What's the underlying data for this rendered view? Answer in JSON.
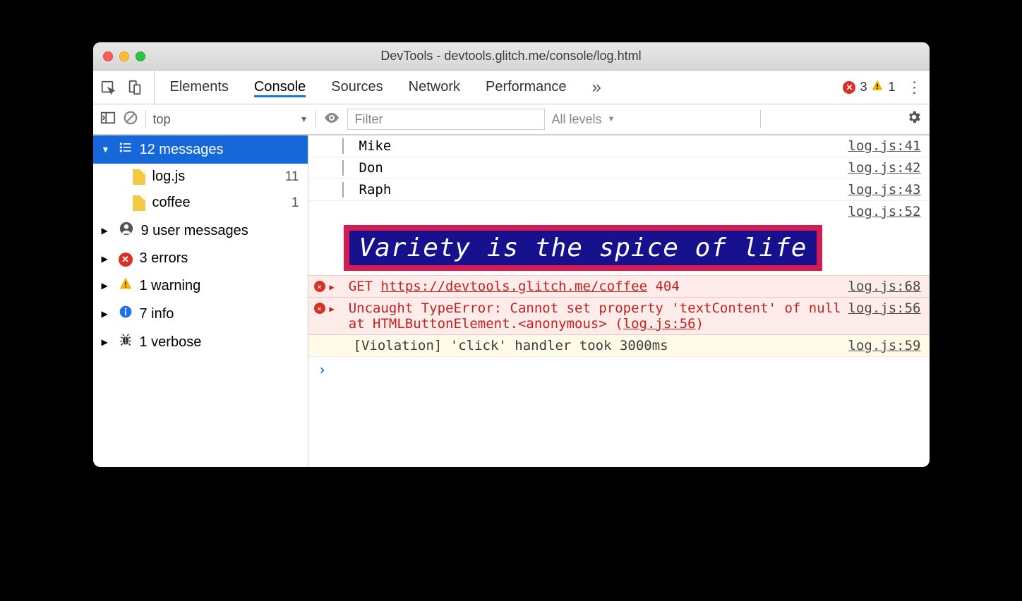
{
  "window": {
    "title": "DevTools - devtools.glitch.me/console/log.html"
  },
  "tabs": [
    "Elements",
    "Console",
    "Sources",
    "Network",
    "Performance"
  ],
  "activeTab": "Console",
  "counts": {
    "errors": "3",
    "warnings": "1"
  },
  "toolbar": {
    "context": "top",
    "filter_placeholder": "Filter",
    "levels": "All levels"
  },
  "sidebar": {
    "messages": {
      "label": "12 messages"
    },
    "files": [
      {
        "name": "log.js",
        "count": "11"
      },
      {
        "name": "coffee",
        "count": "1"
      }
    ],
    "groups": [
      {
        "icon": "user",
        "label": "9 user messages"
      },
      {
        "icon": "error",
        "label": "3 errors"
      },
      {
        "icon": "warning",
        "label": "1 warning"
      },
      {
        "icon": "info",
        "label": "7 info"
      },
      {
        "icon": "verbose",
        "label": "1 verbose"
      }
    ]
  },
  "logs": {
    "names": [
      {
        "txt": "Mike",
        "src": "log.js:41"
      },
      {
        "txt": "Don",
        "src": "log.js:42"
      },
      {
        "txt": "Raph",
        "src": "log.js:43"
      }
    ],
    "styled_src": "log.js:52",
    "styled_text": "Variety is the spice of life",
    "get": {
      "method": "GET",
      "url": "https://devtools.glitch.me/coffee",
      "status": "404",
      "src": "log.js:68"
    },
    "typeerr": {
      "line1": "Uncaught TypeError: Cannot set property 'textContent' of null",
      "line2": "    at HTMLButtonElement.<anonymous> (",
      "linksrc": "log.js:56",
      "tail": ")",
      "src": "log.js:56"
    },
    "violation": {
      "txt": "[Violation] 'click' handler took 3000ms",
      "src": "log.js:59"
    }
  },
  "prompt": "›"
}
